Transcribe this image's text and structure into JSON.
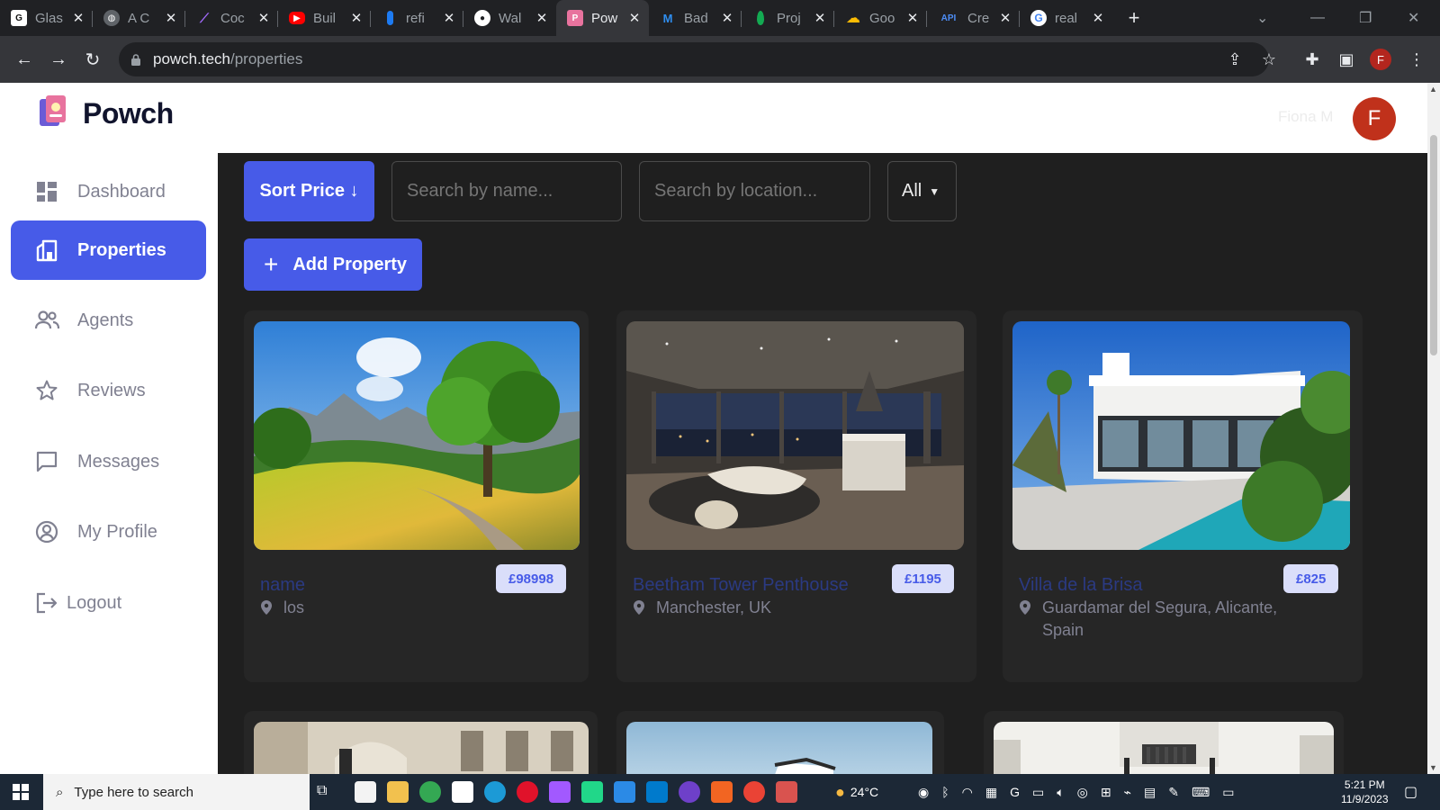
{
  "browser": {
    "tabs": [
      {
        "label": "Glas",
        "icon": "glassdoor-icon",
        "color": "#0caa41"
      },
      {
        "label": "A C",
        "icon": "globe-icon",
        "color": "#5f6368"
      },
      {
        "label": "Coc",
        "icon": "coding-icon",
        "color": "#8a4fff"
      },
      {
        "label": "Buil",
        "icon": "youtube-icon",
        "color": "#ff0000"
      },
      {
        "label": "refi",
        "icon": "refine-icon",
        "color": "#1d7bf2"
      },
      {
        "label": "Wal",
        "icon": "github-icon",
        "color": "#ffffff"
      },
      {
        "label": "Pow",
        "icon": "powch-icon",
        "color": "#e8739e"
      },
      {
        "label": "Bad",
        "icon": "mui-icon",
        "color": "#1976d2"
      },
      {
        "label": "Proj",
        "icon": "mongodb-icon",
        "color": "#13aa52"
      },
      {
        "label": "Goo",
        "icon": "google-cloud-icon",
        "color": "#fbbc04"
      },
      {
        "label": "Cre",
        "icon": "api-icon",
        "color": "#4285f4"
      },
      {
        "label": "real",
        "icon": "google-icon",
        "color": "#4285f4"
      }
    ],
    "url_host": "powch.tech",
    "url_path": "/properties",
    "profile_initial": "F"
  },
  "header": {
    "brand": "Powch",
    "user_name": "Fiona M",
    "avatar_initial": "F"
  },
  "sidebar": {
    "items": [
      {
        "label": "Dashboard",
        "icon": "dashboard-icon"
      },
      {
        "label": "Properties",
        "icon": "properties-icon",
        "active": true
      },
      {
        "label": "Agents",
        "icon": "agents-icon"
      },
      {
        "label": "Reviews",
        "icon": "star-icon"
      },
      {
        "label": "Messages",
        "icon": "messages-icon"
      },
      {
        "label": "My Profile",
        "icon": "profile-icon"
      },
      {
        "label": "Logout",
        "icon": "logout-icon"
      }
    ],
    "collapse_icon": "chevron-left-icon"
  },
  "filters": {
    "sort_label": "Sort Price ↓",
    "search_name_placeholder": "Search by name...",
    "search_location_placeholder": "Search by location...",
    "type_selected": "All",
    "add_label": "Add Property"
  },
  "properties": [
    {
      "title": "name",
      "price": "£98998",
      "location": "los"
    },
    {
      "title": "Beetham Tower Penthouse",
      "price": "£1195",
      "location": "Manchester, UK"
    },
    {
      "title": "Villa de la Brisa",
      "price": "£825",
      "location": "Guardamar del Segura, Alicante, Spain"
    }
  ],
  "taskbar": {
    "search_placeholder": "Type here to search",
    "weather": "24°C",
    "time": "5:21 PM",
    "date": "11/9/2023"
  },
  "colors": {
    "accent": "#475be8",
    "price_bg": "#dadefa",
    "avatar": "#c0311b",
    "card": "#262626",
    "background": "#1f1f1f"
  }
}
